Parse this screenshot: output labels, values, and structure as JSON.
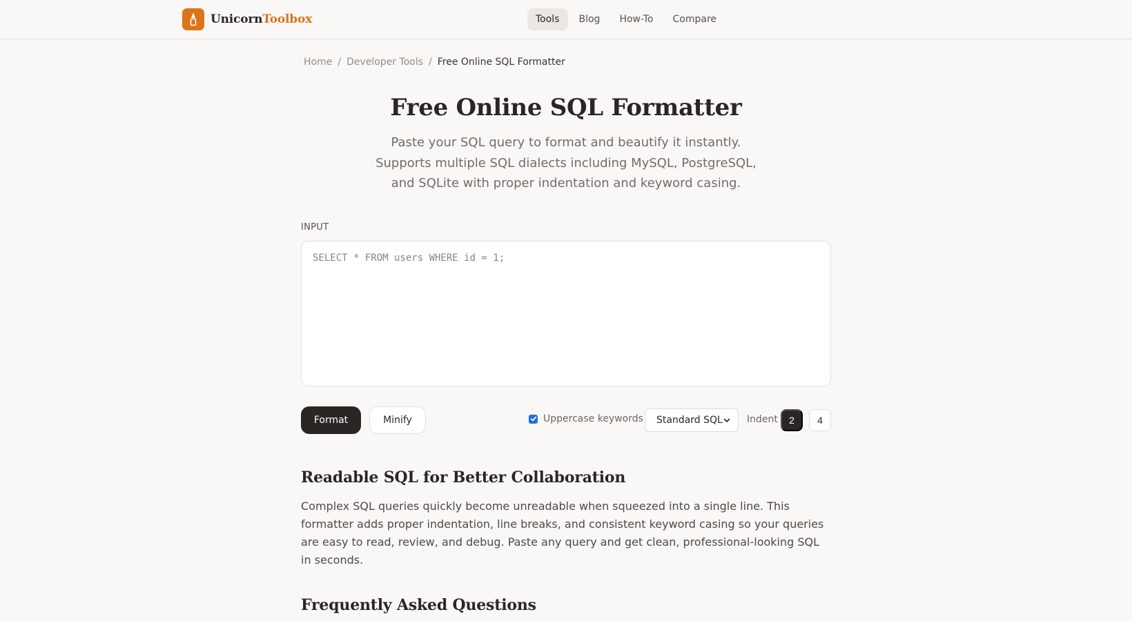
{
  "header": {
    "logo": {
      "word1": "Unicorn",
      "word2": "Toolbox",
      "icon": "unicorn-horn-icon"
    },
    "nav": [
      {
        "label": "Tools",
        "active": true
      },
      {
        "label": "Blog",
        "active": false
      },
      {
        "label": "How-To",
        "active": false
      },
      {
        "label": "Compare",
        "active": false
      }
    ]
  },
  "breadcrumb": {
    "items": [
      "Home",
      "Developer Tools",
      "Free Online SQL Formatter"
    ],
    "separator": "/"
  },
  "hero": {
    "title": "Free Online SQL Formatter",
    "subtitle": "Paste your SQL query to format and beautify it instantly. Supports multiple SQL dialects including MySQL, PostgreSQL, and SQLite with proper indentation and keyword casing."
  },
  "input": {
    "label": "INPUT",
    "value": "",
    "placeholder": "SELECT * FROM users WHERE id = 1;"
  },
  "controls": {
    "format_label": "Format",
    "minify_label": "Minify",
    "uppercase_label": "Uppercase keywords",
    "uppercase_checked": true,
    "dialect_selected": "Standard SQL",
    "indent_label": "Indent",
    "indent_options": [
      "2",
      "4"
    ],
    "indent_selected": "2"
  },
  "sections": {
    "readable": {
      "heading": "Readable SQL for Better Collaboration",
      "body": "Complex SQL queries quickly become unreadable when squeezed into a single line. This formatter adds proper indentation, line breaks, and consistent keyword casing so your queries are easy to read, review, and debug. Paste any query and get clean, professional-looking SQL in seconds."
    },
    "faq": {
      "heading": "Frequently Asked Questions"
    }
  },
  "colors": {
    "accent": "#dd7418",
    "dark": "#2a2624",
    "background": "#f9f8f6",
    "checkbox": "#1f6fe0"
  }
}
